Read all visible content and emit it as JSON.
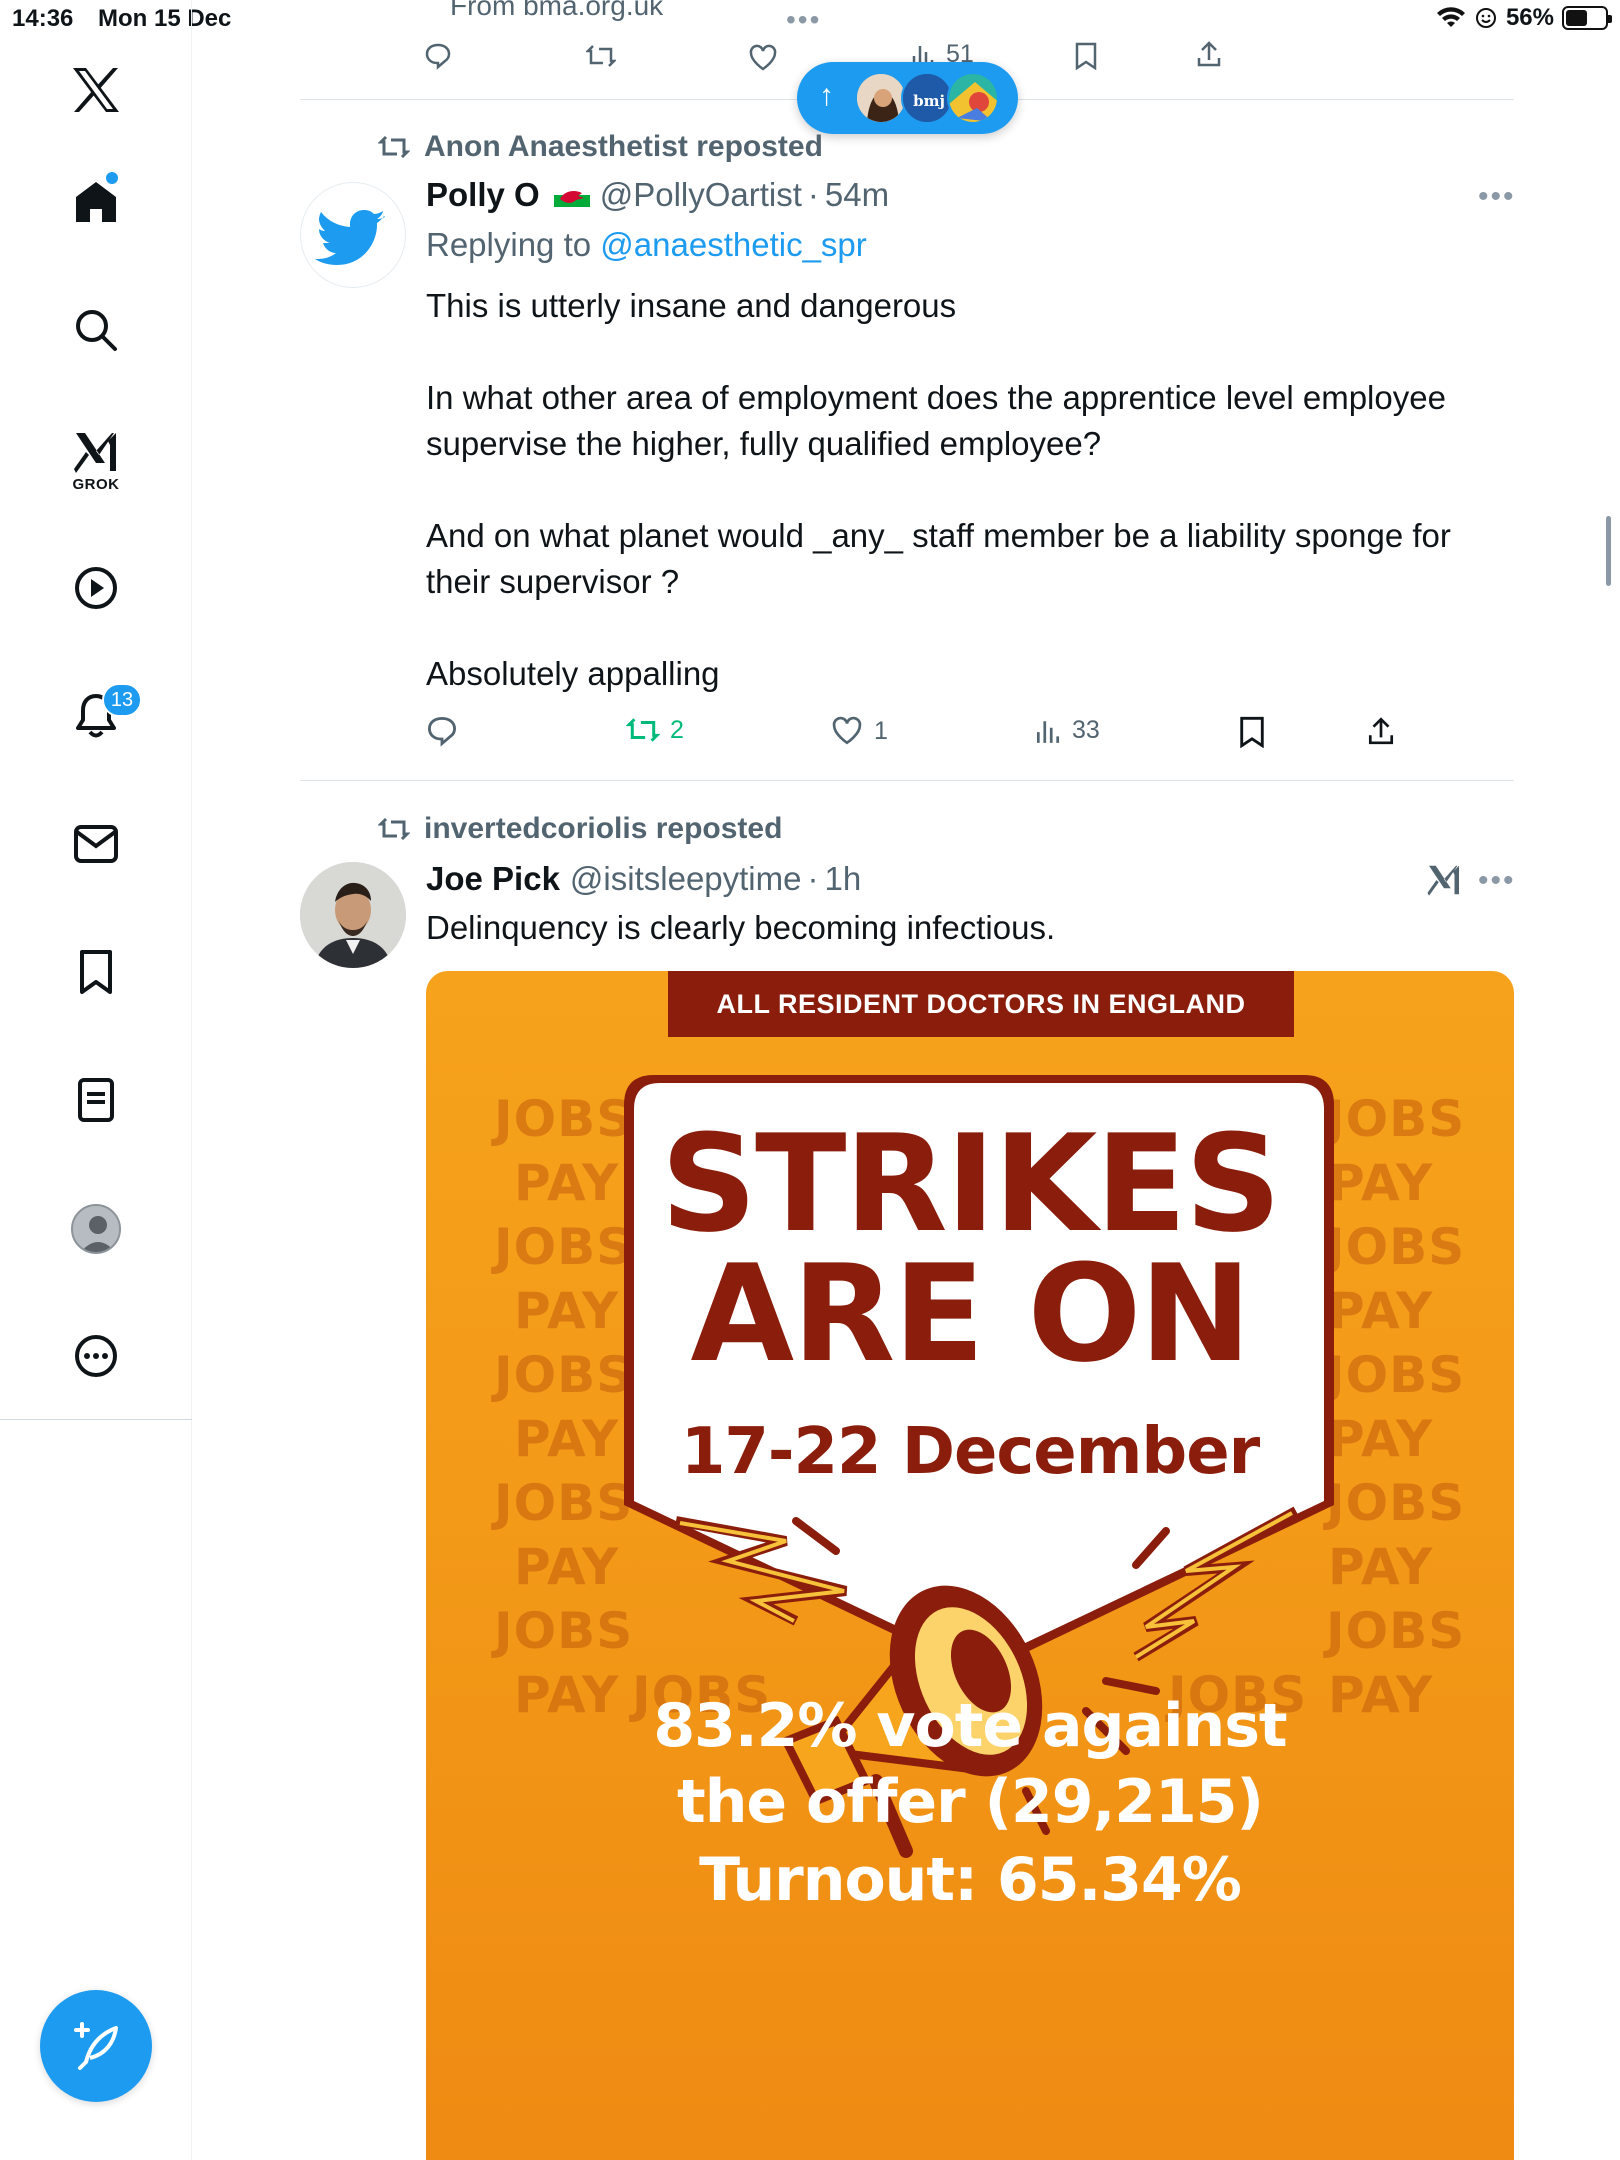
{
  "status_bar": {
    "time": "14:36",
    "date": "Mon 15 Dec",
    "battery": "56%",
    "battery_level": 0.56
  },
  "top_tweet": {
    "source": "From bma.org.uk",
    "views": "51"
  },
  "sidebar": {
    "items": [
      "home",
      "explore",
      "grok",
      "video",
      "notifications",
      "messages",
      "bookmarks",
      "lists",
      "profile",
      "more"
    ],
    "grok_label": "GROK",
    "notification_count": "13"
  },
  "new_posts_pill": {
    "avatars": [
      "person-avatar",
      "bmj-avatar",
      "colorful-avatar"
    ],
    "bmj_label": "bmj"
  },
  "tweets": [
    {
      "reposted_by": "Anon Anaesthetist reposted",
      "name": "Polly O",
      "flag": "🏴",
      "handle": "@PollyOartist",
      "time": "54m",
      "reply_prefix": "Replying to",
      "reply_handle": "@anaesthetic_spr",
      "text": [
        "This is utterly insane and dangerous",
        "In what other area of employment does the apprentice level employee",
        "supervise the higher, fully qualified employee?",
        "And on what planet would _any_ staff member be a liability sponge for",
        "their supervisor ?",
        "Absolutely appalling"
      ],
      "retweets": "2",
      "likes": "1",
      "views": "33"
    },
    {
      "reposted_by": "invertedcoriolis reposted",
      "name": "Joe Pick",
      "handle": "@isitsleepytime",
      "time": "1h",
      "text": "Delinquency is clearly becoming infectious.",
      "poster": {
        "banner": "ALL RESIDENT DOCTORS IN ENGLAND",
        "headline_1": "STRIKES",
        "headline_2": "ARE ON",
        "dates": "17-22 December",
        "stat_1": "83.2% vote against",
        "stat_2": "the offer (29,215)",
        "stat_3": "Turnout: 65.34%",
        "bg_words": [
          "JOBS",
          "PAY"
        ]
      }
    }
  ],
  "colors": {
    "accent": "#1d9bf0",
    "retweet_green": "#00ba7c",
    "poster_orange": "#f39a18",
    "poster_red": "#8a1d0c"
  }
}
